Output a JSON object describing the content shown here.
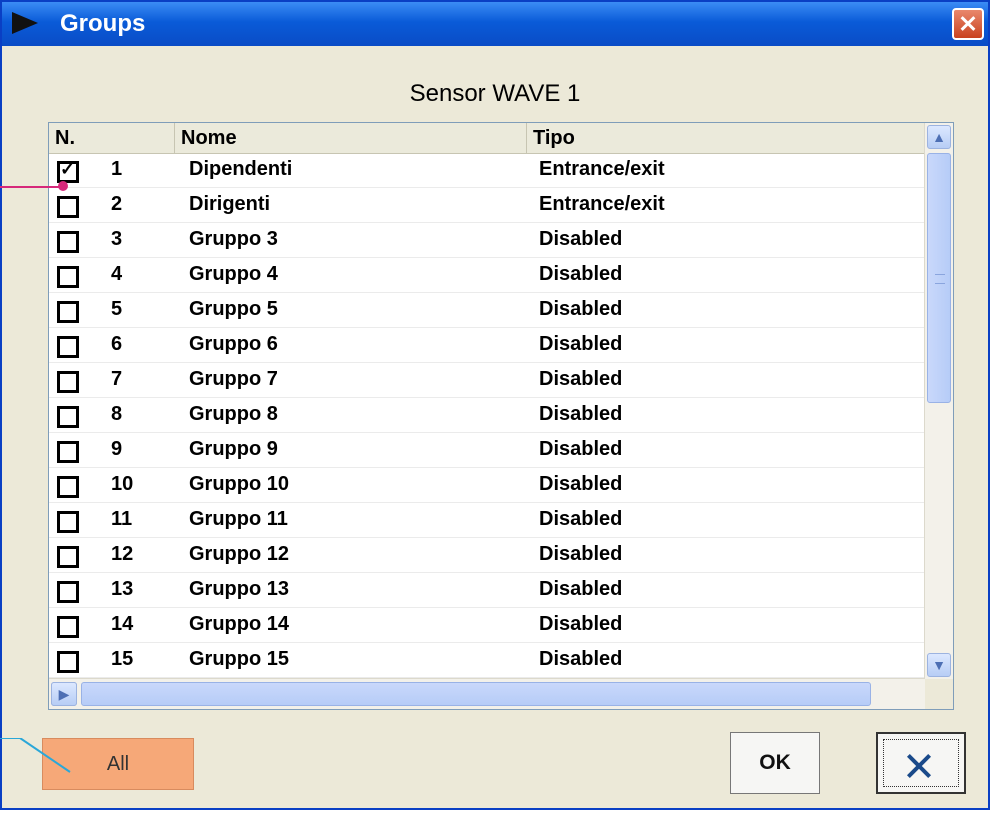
{
  "window": {
    "title": "Groups"
  },
  "sensor_title": "Sensor WAVE 1",
  "columns": {
    "n": "N.",
    "nome": "Nome",
    "tipo": "Tipo"
  },
  "rows": [
    {
      "checked": true,
      "n": "1",
      "nome": "Dipendenti",
      "tipo": "Entrance/exit"
    },
    {
      "checked": false,
      "n": "2",
      "nome": "Dirigenti",
      "tipo": "Entrance/exit"
    },
    {
      "checked": false,
      "n": "3",
      "nome": "Gruppo  3",
      "tipo": "Disabled"
    },
    {
      "checked": false,
      "n": "4",
      "nome": "Gruppo  4",
      "tipo": "Disabled"
    },
    {
      "checked": false,
      "n": "5",
      "nome": "Gruppo  5",
      "tipo": "Disabled"
    },
    {
      "checked": false,
      "n": "6",
      "nome": "Gruppo  6",
      "tipo": "Disabled"
    },
    {
      "checked": false,
      "n": "7",
      "nome": "Gruppo  7",
      "tipo": "Disabled"
    },
    {
      "checked": false,
      "n": "8",
      "nome": "Gruppo  8",
      "tipo": "Disabled"
    },
    {
      "checked": false,
      "n": "9",
      "nome": "Gruppo  9",
      "tipo": "Disabled"
    },
    {
      "checked": false,
      "n": "10",
      "nome": "Gruppo  10",
      "tipo": "Disabled"
    },
    {
      "checked": false,
      "n": "11",
      "nome": "Gruppo  11",
      "tipo": "Disabled"
    },
    {
      "checked": false,
      "n": "12",
      "nome": "Gruppo  12",
      "tipo": "Disabled"
    },
    {
      "checked": false,
      "n": "13",
      "nome": "Gruppo  13",
      "tipo": "Disabled"
    },
    {
      "checked": false,
      "n": "14",
      "nome": "Gruppo  14",
      "tipo": "Disabled"
    },
    {
      "checked": false,
      "n": "15",
      "nome": "Gruppo  15",
      "tipo": "Disabled"
    }
  ],
  "buttons": {
    "all": "All",
    "ok": "OK"
  },
  "icons": {
    "title": "play-arrow-icon",
    "close": "close-icon",
    "cancel": "x-icon"
  },
  "colors": {
    "titlebar": "#0a5bd8",
    "all_button": "#f6a878",
    "callout_pink": "#d6287a",
    "callout_blue": "#2aa7d8"
  }
}
